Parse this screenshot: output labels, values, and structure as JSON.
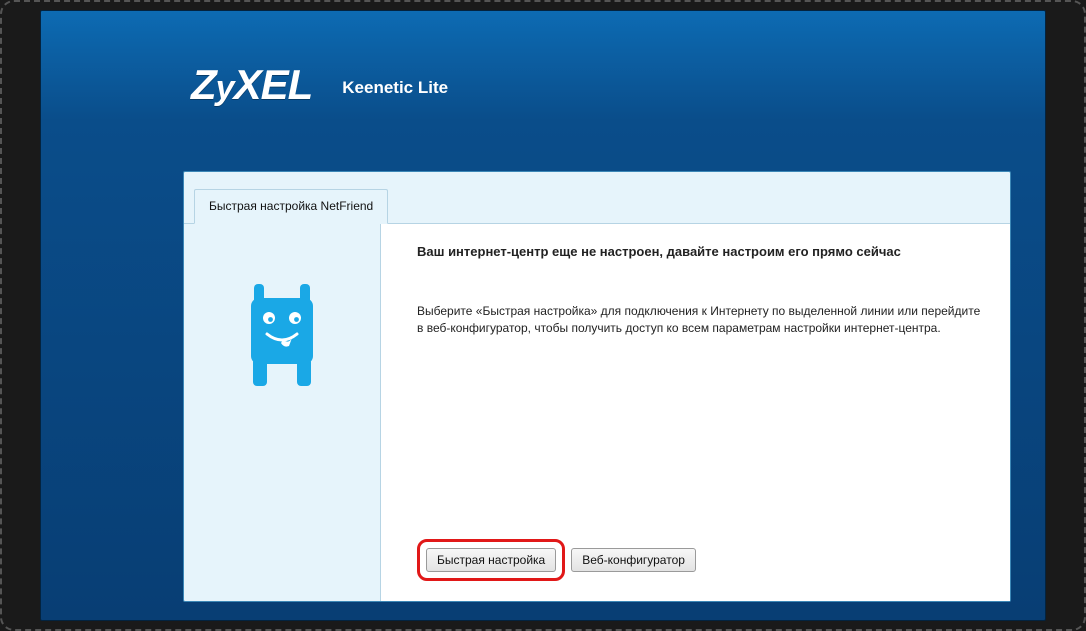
{
  "header": {
    "brand": "ZyXEL",
    "product": "Keenetic Lite"
  },
  "tab": {
    "label": "Быстрая настройка NetFriend"
  },
  "content": {
    "heading": "Ваш интернет-центр еще не настроен, давайте настроим его прямо сейчас",
    "body": "Выберите «Быстрая настройка» для подключения к Интернету по выделенной линии или перейдите в веб-конфигуратор, чтобы получить доступ ко всем параметрам настройки интернет-центра."
  },
  "buttons": {
    "quick": "Быстрая настройка",
    "webconf": "Веб-конфигуратор"
  }
}
